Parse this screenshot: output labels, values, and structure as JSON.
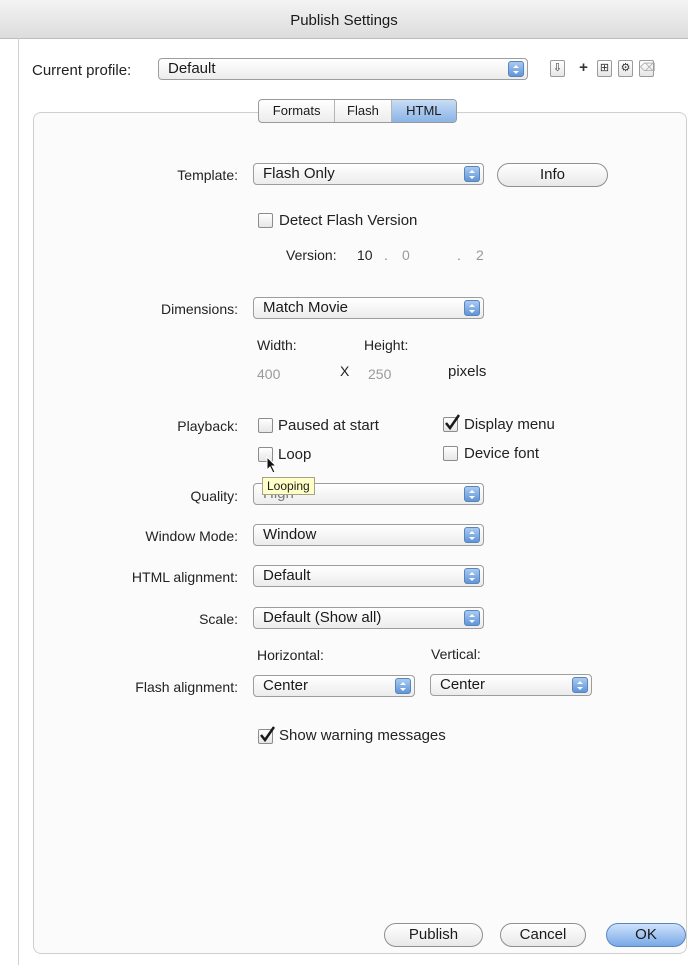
{
  "window": {
    "title": "Publish Settings"
  },
  "profile": {
    "label": "Current profile:",
    "value": "Default"
  },
  "toolbar": [
    {
      "name": "import-export-profile-icon",
      "glyph": "⇩"
    },
    {
      "name": "create-profile-icon",
      "glyph": "+"
    },
    {
      "name": "duplicate-profile-icon",
      "glyph": "⊞"
    },
    {
      "name": "profile-settings-icon",
      "glyph": "⚙"
    },
    {
      "name": "delete-profile-icon",
      "glyph": "🗑"
    }
  ],
  "tabs": [
    {
      "label": "Formats",
      "selected": false
    },
    {
      "label": "Flash",
      "selected": false
    },
    {
      "label": "HTML",
      "selected": true
    }
  ],
  "template": {
    "label": "Template:",
    "value": "Flash Only",
    "info_button": "Info"
  },
  "detect": {
    "label": "Detect Flash Version",
    "checked": false
  },
  "version": {
    "label": "Version:",
    "major": "10",
    "minor": "0",
    "revision": "2"
  },
  "dimensions": {
    "label": "Dimensions:",
    "value": "Match Movie",
    "width_label": "Width:",
    "height_label": "Height:",
    "width": "400",
    "height": "250",
    "times": "X",
    "units": "pixels"
  },
  "playback": {
    "label": "Playback:",
    "paused": {
      "label": "Paused at start",
      "checked": false
    },
    "display_menu": {
      "label": "Display menu",
      "checked": true
    },
    "loop": {
      "label": "Loop",
      "checked": false
    },
    "device_font": {
      "label": "Device font",
      "checked": false
    },
    "tooltip": "Looping"
  },
  "quality": {
    "label": "Quality:",
    "value": "High"
  },
  "window_mode": {
    "label": "Window Mode:",
    "value": "Window"
  },
  "html_alignment": {
    "label": "HTML alignment:",
    "value": "Default"
  },
  "scale": {
    "label": "Scale:",
    "value": "Default (Show all)"
  },
  "flash_alignment": {
    "label": "Flash alignment:",
    "horizontal_label": "Horizontal:",
    "vertical_label": "Vertical:",
    "horizontal": "Center",
    "vertical": "Center"
  },
  "warnings": {
    "label": "Show warning messages",
    "checked": true
  },
  "buttons": {
    "publish": "Publish",
    "cancel": "Cancel",
    "ok": "OK"
  },
  "colors": {
    "accent": "#6f9fdf",
    "tooltip_bg": "#ffffc7"
  }
}
